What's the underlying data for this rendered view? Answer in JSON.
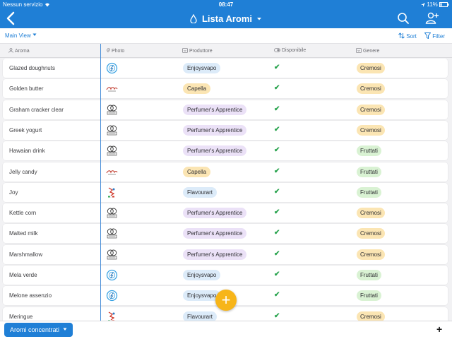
{
  "status_bar": {
    "carrier": "Nessun servizio",
    "time": "08:47",
    "battery": "11%"
  },
  "nav": {
    "title": "Lista Aromi"
  },
  "toolbar": {
    "view_label": "Main View",
    "sort_label": "Sort",
    "filter_label": "Filter"
  },
  "columns": {
    "aroma": "Aroma",
    "photo": "Photo",
    "produttore": "Produttore",
    "disponibile": "Disponibile",
    "genere": "Genere"
  },
  "colors": {
    "accent": "#1f7fd6",
    "fab": "#f7b519",
    "check": "#2aa44f",
    "producer_tags": {
      "Enjoysvapo": "#dcebf9",
      "Capella": "#fbe5b3",
      "Perfumer's Apprentice": "#ebe1f7",
      "Flavourart": "#dcebf9"
    },
    "genre_tags": {
      "Cremosi": "#fbe5b3",
      "Fruttati": "#d9f2d3"
    }
  },
  "rows": [
    {
      "aroma": "Glazed doughnuts",
      "photo_icon": "enjoysvapo-logo",
      "produttore": "Enjoysvapo",
      "disponibile": "✔",
      "genere": "Cremosi"
    },
    {
      "aroma": "Golden butter",
      "photo_icon": "capella-logo",
      "produttore": "Capella",
      "disponibile": "✔",
      "genere": "Cremosi"
    },
    {
      "aroma": "Graham cracker clear",
      "photo_icon": "perfumers-apprentice-logo",
      "produttore": "Perfumer's Apprentice",
      "disponibile": "✔",
      "genere": "Cremosi"
    },
    {
      "aroma": "Greek yogurt",
      "photo_icon": "perfumers-apprentice-logo",
      "produttore": "Perfumer's Apprentice",
      "disponibile": "✔",
      "genere": "Cremosi"
    },
    {
      "aroma": "Hawaian drink",
      "photo_icon": "perfumers-apprentice-logo",
      "produttore": "Perfumer's Apprentice",
      "disponibile": "✔",
      "genere": "Fruttati"
    },
    {
      "aroma": "Jelly candy",
      "photo_icon": "capella-logo",
      "produttore": "Capella",
      "disponibile": "✔",
      "genere": "Fruttati"
    },
    {
      "aroma": "Joy",
      "photo_icon": "flavourart-logo",
      "produttore": "Flavourart",
      "disponibile": "✔",
      "genere": "Fruttati"
    },
    {
      "aroma": "Kettle corn",
      "photo_icon": "perfumers-apprentice-logo",
      "produttore": "Perfumer's Apprentice",
      "disponibile": "✔",
      "genere": "Cremosi"
    },
    {
      "aroma": "Malted milk",
      "photo_icon": "perfumers-apprentice-logo",
      "produttore": "Perfumer's Apprentice",
      "disponibile": "✔",
      "genere": "Cremosi"
    },
    {
      "aroma": "Marshmallow",
      "photo_icon": "perfumers-apprentice-logo",
      "produttore": "Perfumer's Apprentice",
      "disponibile": "✔",
      "genere": "Cremosi"
    },
    {
      "aroma": "Mela verde",
      "photo_icon": "enjoysvapo-logo",
      "produttore": "Enjoysvapo",
      "disponibile": "✔",
      "genere": "Fruttati"
    },
    {
      "aroma": "Melone assenzio",
      "photo_icon": "enjoysvapo-logo",
      "produttore": "Enjoysvapo",
      "disponibile": "✔",
      "genere": "Fruttati"
    },
    {
      "aroma": "Meringue",
      "photo_icon": "flavourart-logo",
      "produttore": "Flavourart",
      "disponibile": "✔",
      "genere": "Cremosi"
    }
  ],
  "bottom_bar": {
    "table_button_label": "Aromi concentrati"
  }
}
